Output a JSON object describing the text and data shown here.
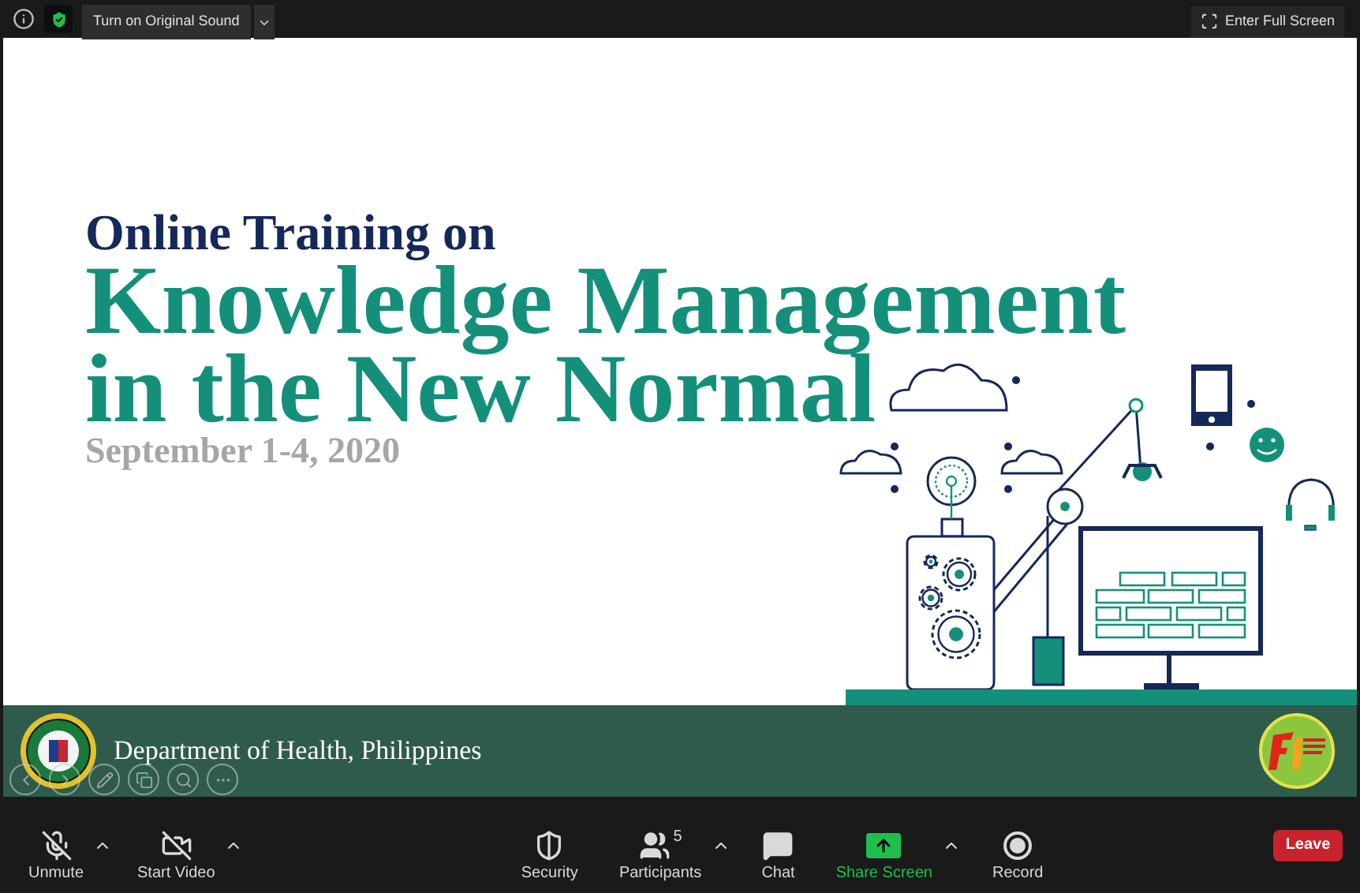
{
  "top_bar": {
    "sound_button": "Turn on Original Sound",
    "fullscreen_button": "Enter Full Screen"
  },
  "slide": {
    "subtitle": "Online Training on",
    "title_lines": [
      "Knowledge Management",
      "in the New Normal"
    ],
    "date": "September 1-4, 2020",
    "footer": "Department of Health, Philippines"
  },
  "toolbar": {
    "left": [
      {
        "kind": "mic",
        "label": "Unmute",
        "off": true,
        "caret": true
      },
      {
        "kind": "video",
        "label": "Start Video",
        "off": true,
        "caret": true
      }
    ],
    "center": [
      {
        "kind": "security",
        "label": "Security",
        "caret": false
      },
      {
        "kind": "participants",
        "label": "Participants",
        "count": "5",
        "caret": true
      },
      {
        "kind": "chat",
        "label": "Chat",
        "caret": false
      },
      {
        "kind": "share",
        "label": "Share Screen",
        "caret": true
      },
      {
        "kind": "record",
        "label": "Record",
        "caret": false
      }
    ],
    "leave_button": "Leave"
  }
}
